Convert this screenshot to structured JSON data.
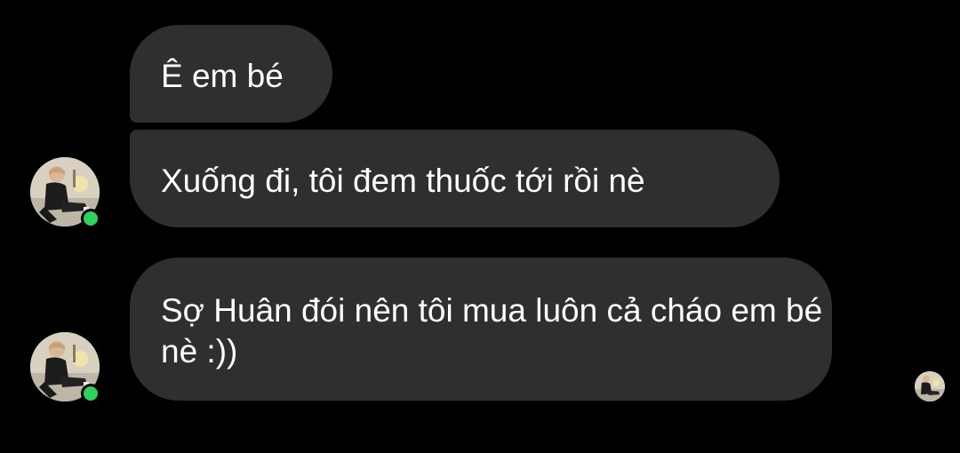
{
  "messages": [
    {
      "sender": "other",
      "text": "Ê em bé"
    },
    {
      "sender": "other",
      "text": "Xuống đi, tôi đem thuốc tới rồi nè"
    },
    {
      "sender": "other",
      "text": "Sợ Huân đói nên tôi mua luôn cả cháo em bé nè :))"
    }
  ],
  "colors": {
    "background": "#000000",
    "bubble": "#2f2f2f",
    "text": "#ffffff",
    "online_indicator": "#31d05e"
  },
  "icons": {
    "sender_avatar": "avatar-photo",
    "online_status": "online-dot",
    "read_receipt": "seen-avatar"
  }
}
